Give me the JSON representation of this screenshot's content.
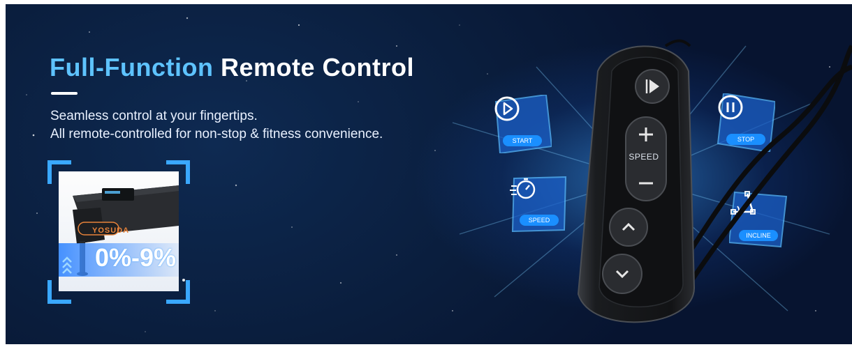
{
  "headline": {
    "accent": "Full-Function",
    "rest": "Remote Control"
  },
  "subtitle": {
    "line1": "Seamless control at your fingertips.",
    "line2": "All remote-controlled for non-stop & fitness convenience."
  },
  "thumbnail": {
    "brand": "YOSUDA",
    "incline_range": "0%-9%"
  },
  "features": {
    "start": "START",
    "speed": "SPEED",
    "stop": "STOP",
    "incline": "INCLINE"
  },
  "remote": {
    "speed_label": "SPEED",
    "buttons": [
      "play-pause",
      "speed-up",
      "speed-down",
      "incline-up",
      "incline-down"
    ]
  },
  "colors": {
    "accent": "#5ec3ff",
    "card_blue": "#1a8fff",
    "frame_blue": "#3aa8ff",
    "brand_orange": "#e8833a"
  }
}
